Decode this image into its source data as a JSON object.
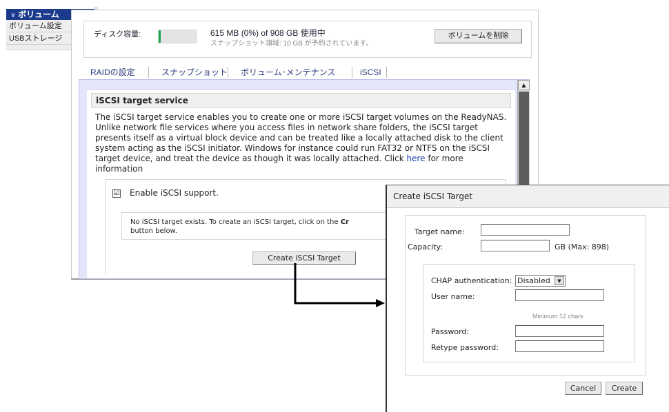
{
  "sidebar": {
    "header": "ボリューム",
    "items": [
      "ボリューム設定",
      "USBストレージ"
    ]
  },
  "disk": {
    "label": "ディスク容量:",
    "usage": "615 MB (0%) of 908 GB 使用中",
    "snapshot_note": "スナップショット領域: 10 GB が予約されています。",
    "delete_button": "ボリュームを削除",
    "used_fraction": 0.0,
    "bar_color": "#1aa84a"
  },
  "tabs": [
    "RAIDの設定",
    "スナップショット",
    "ボリューム･メンテナンス",
    "iSCSI"
  ],
  "iscsi": {
    "title": "iSCSI target service",
    "description": "The iSCSI target service enables you to create one or more iSCSI target volumes on the ReadyNAS. Unlike network file services where you access files in network share folders, the iSCSI target presents itself as a virtual block device and can be treated like a locally attached disk to the client system acting as the iSCSI initiator. Windows for instance could run FAT32 or NTFS on the iSCSI target device, and treat the device as though it was locally attached. Click ",
    "link_text": "here",
    "description_tail": " for more information",
    "enable_label": "Enable iSCSI support.",
    "enable_checked": "☑",
    "no_target_msg": "No iSCSI target exists. To create an iSCSI target, click on the ",
    "no_target_bold": "Cr",
    "no_target_tail": "button below.",
    "create_button": "Create iSCSI Target"
  },
  "dialog": {
    "title": "Create iSCSI Target",
    "target_name_label": "Target name:",
    "target_name_value": "",
    "capacity_label": "Capacity:",
    "capacity_value": "",
    "capacity_unit": "GB (Max: 898)",
    "chap_label": "CHAP authentication:",
    "chap_value": "Disabled",
    "username_label": "User name:",
    "username_value": "",
    "username_hint": "Minimum 12 chars",
    "password_label": "Password:",
    "retype_label": "Retype password:",
    "cancel_button": "Cancel",
    "create_button": "Create"
  },
  "colors": {
    "accent_blue": "#1c3a8c",
    "panel_lavender": "#e3e5fb"
  }
}
